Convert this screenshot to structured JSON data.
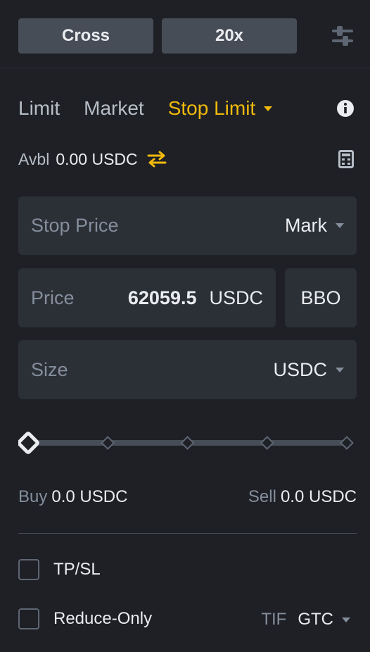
{
  "header": {
    "margin_mode": "Cross",
    "leverage": "20x",
    "settings_icon": "sliders-icon"
  },
  "order_tabs": {
    "limit": "Limit",
    "market": "Market",
    "stop_limit": "Stop Limit",
    "active": "Stop Limit",
    "info_icon": "info-icon"
  },
  "available": {
    "label": "Avbl",
    "value": "0.00 USDC",
    "swap_icon": "swap-icon",
    "calculator_icon": "calculator-icon"
  },
  "stop_price": {
    "label": "Stop Price",
    "trigger": "Mark"
  },
  "price": {
    "label": "Price",
    "value": "62059.5",
    "unit": "USDC",
    "bbo": "BBO"
  },
  "size": {
    "label": "Size",
    "unit": "USDC"
  },
  "slider": {
    "value_percent": 0,
    "marks_percent": [
      0,
      25,
      50,
      75,
      100
    ]
  },
  "cost": {
    "buy_label": "Buy",
    "buy_value": "0.0 USDC",
    "sell_label": "Sell",
    "sell_value": "0.0 USDC"
  },
  "options": {
    "tpsl_label": "TP/SL",
    "tpsl_checked": false,
    "reduce_only_label": "Reduce-Only",
    "reduce_only_checked": false,
    "tif_label": "TIF",
    "tif_value": "GTC"
  },
  "colors": {
    "accent": "#f0b90b",
    "background": "#1e2026",
    "input_bg": "#2b2f36",
    "muted_text": "#848e9c"
  }
}
